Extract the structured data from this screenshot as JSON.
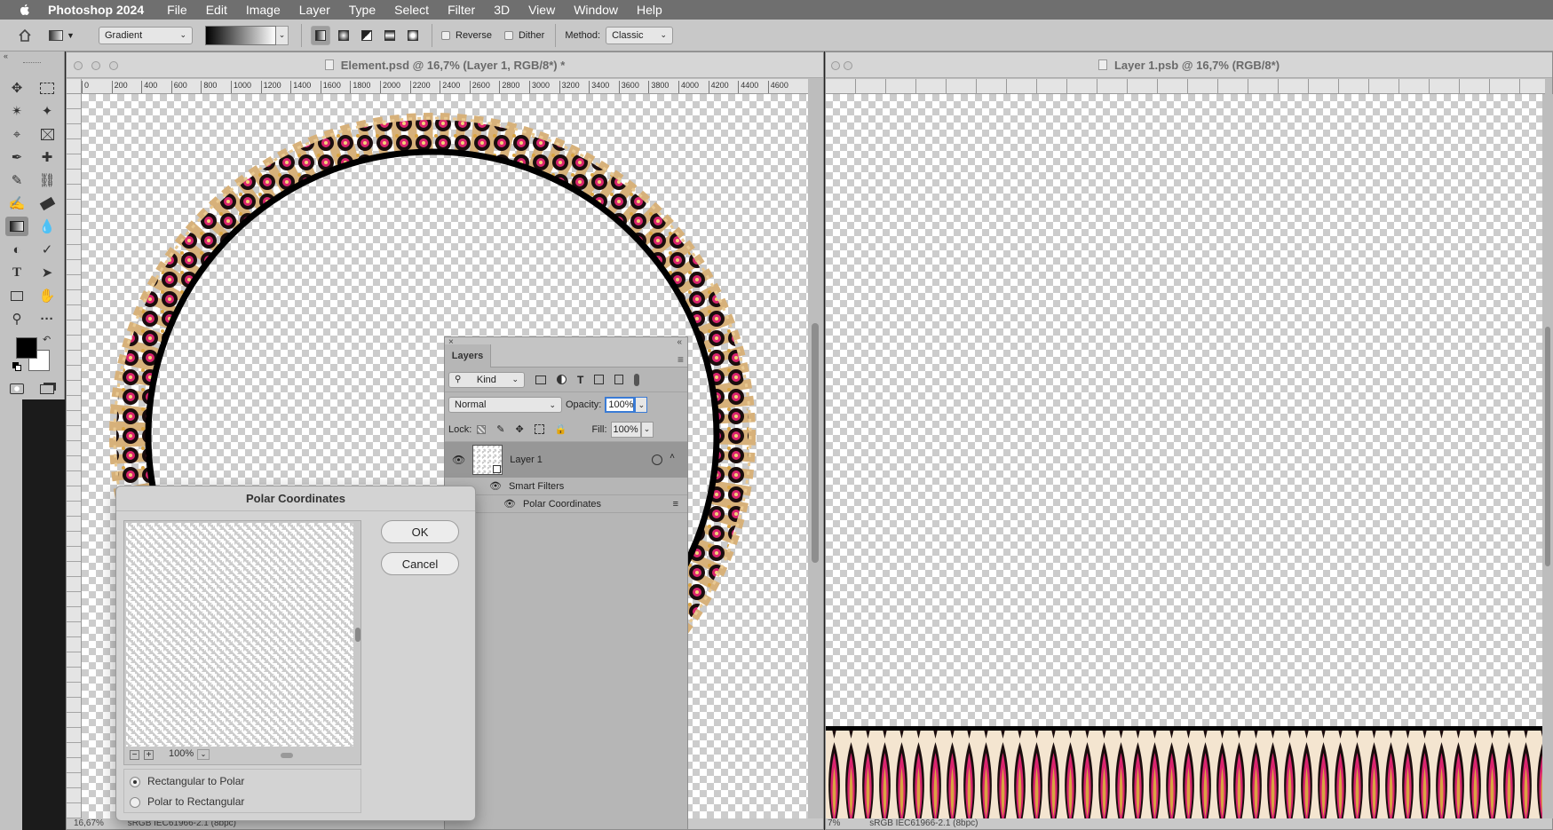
{
  "menubar": {
    "app_name": "Photoshop 2024",
    "items": [
      "File",
      "Edit",
      "Image",
      "Layer",
      "Type",
      "Select",
      "Filter",
      "3D",
      "View",
      "Window",
      "Help"
    ]
  },
  "options_bar": {
    "preset": "Gradient",
    "reverse_label": "Reverse",
    "dither_label": "Dither",
    "method_label": "Method:",
    "method_value": "Classic"
  },
  "doc1": {
    "title": "Element.psd @ 16,7% (Layer 1, RGB/8*) *",
    "ruler_ticks": [
      "0",
      "200",
      "400",
      "600",
      "800",
      "1000",
      "1200",
      "1400",
      "1600",
      "1800",
      "2000",
      "2200",
      "2400",
      "2600",
      "2800",
      "3000",
      "3200",
      "3400",
      "3600",
      "3800",
      "4000",
      "4200",
      "4400",
      "4600"
    ],
    "zoom_status": "16,67%",
    "profile_status": "sRGB IEC61966-2.1 (8bpc)"
  },
  "doc2": {
    "title": "Layer 1.psb @ 16,7% (RGB/8*)",
    "zoom_status": "7%",
    "profile_status": "sRGB IEC61966-2.1 (8bpc)"
  },
  "layers_panel": {
    "tab_label": "Layers",
    "kind_label": "Kind",
    "blend_mode": "Normal",
    "opacity_label": "Opacity:",
    "opacity_value": "100%",
    "lock_label": "Lock:",
    "fill_label": "Fill:",
    "fill_value": "100%",
    "layer_name": "Layer 1",
    "smart_filters_label": "Smart Filters",
    "filter_name": "Polar Coordinates"
  },
  "dialog": {
    "title": "Polar Coordinates",
    "ok_label": "OK",
    "cancel_label": "Cancel",
    "zoom_value": "100%",
    "option_1": "Rectangular to Polar",
    "option_2": "Polar to Rectangular",
    "selected_option": "Rectangular to Polar"
  },
  "colors": {
    "foreground": "#000000",
    "background": "#ffffff",
    "ornament_pink": "#d9246e",
    "ornament_gold": "#d9a441"
  }
}
